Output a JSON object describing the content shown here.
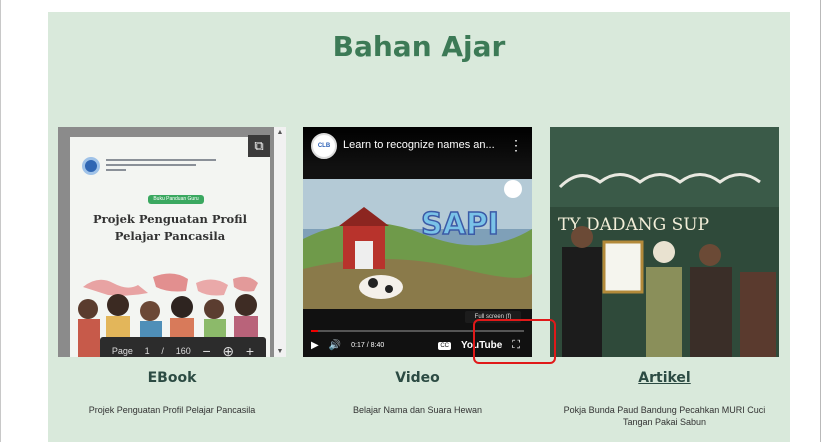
{
  "section": {
    "title": "Bahan Ajar"
  },
  "cards": [
    {
      "caption": "EBook",
      "description": "Projek Penguatan Profil Pelajar Pancasila",
      "ebook": {
        "badge": "Buku Panduan Guru",
        "title": "Projek Penguatan Profil Pelajar Pancasila",
        "toolbar": {
          "page_label": "Page",
          "page_current": "1",
          "page_sep": "/",
          "page_total": "160",
          "zoom_out_icon": "minus-icon",
          "zoom_icon": "zoom-icon",
          "zoom_in_icon": "plus-icon"
        },
        "open_external_icon": "open-external-icon"
      }
    },
    {
      "caption": "Video",
      "description": "Belajar Nama dan Suara Hewan",
      "video": {
        "title": "Learn to recognize names an...",
        "logo_text": "SAPI",
        "time": "0:17 / 8:40",
        "tooltip": "Full screen (f)",
        "progress": 0.033,
        "cc_label": "CC",
        "brand_label": "YouTube"
      }
    },
    {
      "caption": "Artikel",
      "description": "Pokja Bunda Paud Bandung Pecahkan MURI Cuci Tangan Pakai Sabun",
      "photo_text": "TY DADANG SUP"
    }
  ],
  "colors": {
    "section_bg": "#d9e9db",
    "title": "#3c7a56",
    "caption": "#2c4b43",
    "highlight": "#e01919"
  }
}
